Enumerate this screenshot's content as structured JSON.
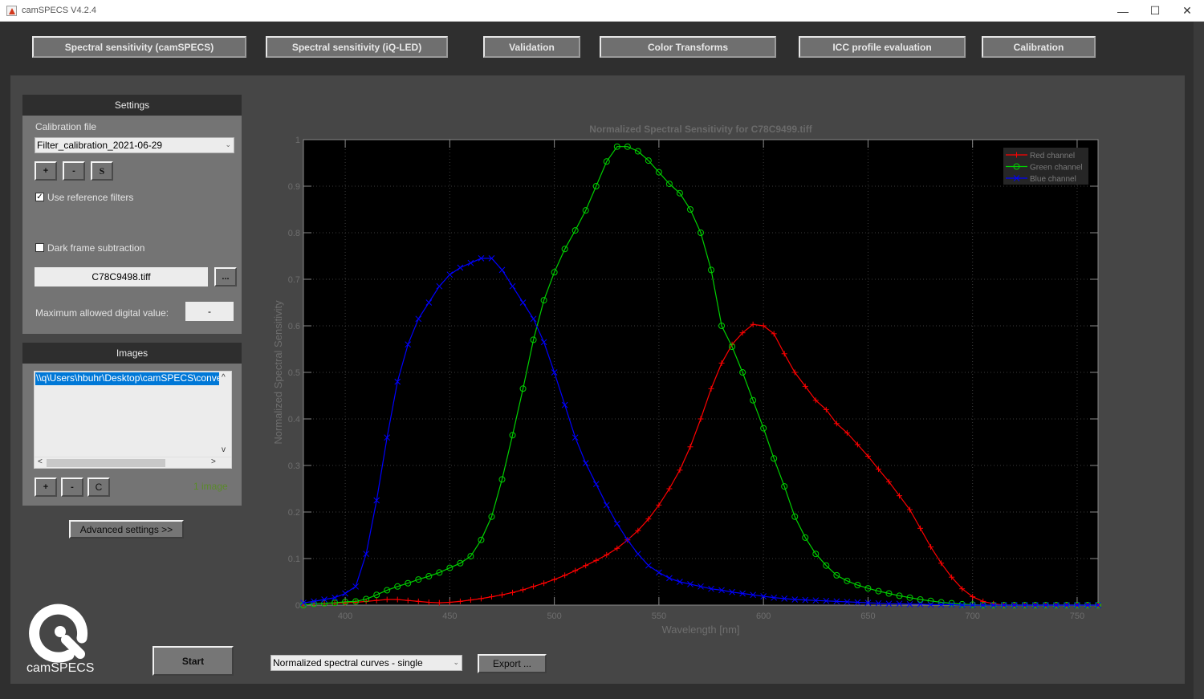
{
  "window": {
    "title": "camSPECS V4.2.4",
    "controls": {
      "minimize": "—",
      "maximize": "☐",
      "close": "✕"
    }
  },
  "tabs": [
    {
      "label": "Spectral sensitivity (camSPECS)"
    },
    {
      "label": "Spectral sensitivity (iQ-LED)"
    },
    {
      "label": "Validation"
    },
    {
      "label": "Color Transforms"
    },
    {
      "label": "ICC profile evaluation"
    },
    {
      "label": "Calibration"
    }
  ],
  "settings": {
    "header": "Settings",
    "calibration_file_label": "Calibration file",
    "calibration_file_value": "Filter_calibration_2021-06-29",
    "buttons": {
      "add": "+",
      "remove": "-",
      "save": "S"
    },
    "use_reference_filters": {
      "label": "Use reference filters",
      "checked": true,
      "mark": "✓"
    },
    "dark_frame_subtraction": {
      "label": "Dark frame subtraction",
      "checked": false,
      "mark": ""
    },
    "dark_frame_file": "C78C9498.tiff",
    "browse_button": "...",
    "max_digital_value_label": "Maximum allowed digital value:",
    "max_digital_value": "-"
  },
  "images": {
    "header": "Images",
    "list": [
      "\\\\q\\Users\\hbuhr\\Desktop\\camSPECS\\converted"
    ],
    "buttons": {
      "add": "+",
      "remove": "-",
      "clear": "C"
    },
    "count_label": "1 image",
    "count_color": "#5a8a2a",
    "scroll_up": "^",
    "scroll_down": "v",
    "scroll_left": "<",
    "scroll_right": ">"
  },
  "advanced_settings_button": "Advanced settings >>",
  "start_button": "Start",
  "logo_text": "camSPECS",
  "plot_mode_select": "Normalized spectral curves - single",
  "export_button": "Export ...",
  "chart_data": {
    "type": "line",
    "title": "Normalized Spectral Sensitivity for C78C9499.tiff",
    "xlabel": "Wavelength [nm]",
    "ylabel": "Normalized Spectral Sensitivity",
    "xlim": [
      380,
      760
    ],
    "ylim": [
      0,
      1
    ],
    "xticks": [
      400,
      450,
      500,
      550,
      600,
      650,
      700,
      750
    ],
    "yticks": [
      0,
      0.1,
      0.2,
      0.3,
      0.4,
      0.5,
      0.6,
      0.7,
      0.8,
      0.9,
      1
    ],
    "ytick_labels": [
      "0",
      "0.1",
      "0.2",
      "0.3",
      "0.4",
      "0.5",
      "0.6",
      "0.7",
      "0.8",
      "0.9",
      "1"
    ],
    "grid": true,
    "legend_position": "top-right",
    "x": [
      380,
      385,
      390,
      395,
      400,
      405,
      410,
      415,
      420,
      425,
      430,
      435,
      440,
      445,
      450,
      455,
      460,
      465,
      470,
      475,
      480,
      485,
      490,
      495,
      500,
      505,
      510,
      515,
      520,
      525,
      530,
      535,
      540,
      545,
      550,
      555,
      560,
      565,
      570,
      575,
      580,
      585,
      590,
      595,
      600,
      605,
      610,
      615,
      620,
      625,
      630,
      635,
      640,
      645,
      650,
      655,
      660,
      665,
      670,
      675,
      680,
      685,
      690,
      695,
      700,
      705,
      710,
      715,
      720,
      725,
      730,
      735,
      740,
      745,
      750,
      755,
      760
    ],
    "series": [
      {
        "name": "Red channel",
        "color": "#ff0000",
        "marker": "+",
        "values": [
          0.0,
          0.003,
          0.004,
          0.004,
          0.005,
          0.006,
          0.008,
          0.01,
          0.012,
          0.012,
          0.01,
          0.008,
          0.006,
          0.005,
          0.006,
          0.008,
          0.011,
          0.014,
          0.018,
          0.022,
          0.027,
          0.033,
          0.04,
          0.047,
          0.055,
          0.064,
          0.074,
          0.085,
          0.096,
          0.108,
          0.122,
          0.14,
          0.16,
          0.185,
          0.215,
          0.25,
          0.29,
          0.34,
          0.4,
          0.465,
          0.52,
          0.56,
          0.585,
          0.603,
          0.6,
          0.583,
          0.54,
          0.5,
          0.47,
          0.44,
          0.42,
          0.39,
          0.37,
          0.345,
          0.32,
          0.292,
          0.265,
          0.235,
          0.205,
          0.165,
          0.125,
          0.09,
          0.06,
          0.035,
          0.018,
          0.008,
          0.003,
          0.0,
          0.0,
          0.0,
          0.0,
          0.0,
          0.0,
          0.0,
          0.0,
          0.0,
          0.0
        ]
      },
      {
        "name": "Green channel",
        "color": "#00d000",
        "marker": "o",
        "values": [
          0.0,
          0.003,
          0.004,
          0.005,
          0.007,
          0.008,
          0.013,
          0.022,
          0.032,
          0.04,
          0.047,
          0.055,
          0.062,
          0.07,
          0.08,
          0.09,
          0.105,
          0.14,
          0.19,
          0.27,
          0.365,
          0.465,
          0.57,
          0.655,
          0.715,
          0.765,
          0.805,
          0.848,
          0.9,
          0.953,
          0.985,
          0.985,
          0.975,
          0.955,
          0.93,
          0.905,
          0.885,
          0.85,
          0.8,
          0.72,
          0.6,
          0.555,
          0.5,
          0.44,
          0.38,
          0.315,
          0.255,
          0.19,
          0.145,
          0.11,
          0.085,
          0.064,
          0.052,
          0.043,
          0.036,
          0.03,
          0.025,
          0.02,
          0.016,
          0.012,
          0.009,
          0.006,
          0.004,
          0.002,
          0.001,
          0.0,
          0.0,
          0.0,
          0.0,
          0.0,
          0.0,
          0.0,
          0.0,
          0.0,
          0.0,
          0.0,
          0.0
        ]
      },
      {
        "name": "Blue channel",
        "color": "#0000ff",
        "marker": "x",
        "values": [
          0.005,
          0.008,
          0.012,
          0.016,
          0.025,
          0.04,
          0.11,
          0.225,
          0.36,
          0.48,
          0.56,
          0.615,
          0.65,
          0.685,
          0.71,
          0.725,
          0.735,
          0.745,
          0.745,
          0.72,
          0.685,
          0.65,
          0.615,
          0.565,
          0.5,
          0.43,
          0.36,
          0.305,
          0.26,
          0.215,
          0.175,
          0.14,
          0.11,
          0.085,
          0.07,
          0.058,
          0.05,
          0.045,
          0.04,
          0.035,
          0.032,
          0.028,
          0.025,
          0.022,
          0.019,
          0.016,
          0.014,
          0.012,
          0.011,
          0.01,
          0.009,
          0.008,
          0.007,
          0.006,
          0.005,
          0.004,
          0.003,
          0.003,
          0.002,
          0.002,
          0.001,
          0.001,
          0.001,
          0.0,
          0.0,
          0.0,
          0.0,
          0.0,
          0.0,
          0.0,
          0.0,
          0.0,
          0.0,
          0.0,
          0.0,
          0.0,
          0.0
        ]
      }
    ]
  }
}
